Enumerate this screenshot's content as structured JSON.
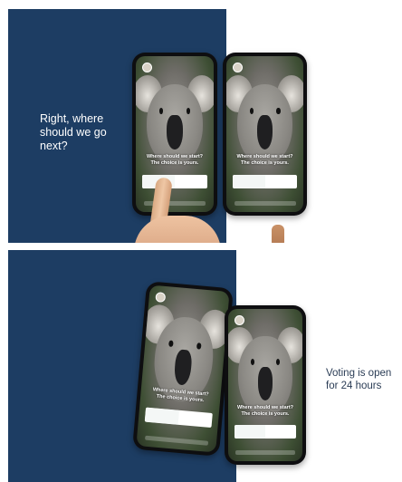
{
  "captions": {
    "top": "Right, where should we go next?",
    "bottom": "Voting is open for 24 hours"
  },
  "story": {
    "handle": "",
    "question_line1": "Where should we start?",
    "question_line2": "The choice is yours.",
    "option_a": "",
    "option_b": "",
    "percent_a": "",
    "percent_b": ""
  },
  "colors": {
    "panel_blue": "#1d3d63",
    "option_a": "#3da98f",
    "option_b": "#e0566a"
  }
}
